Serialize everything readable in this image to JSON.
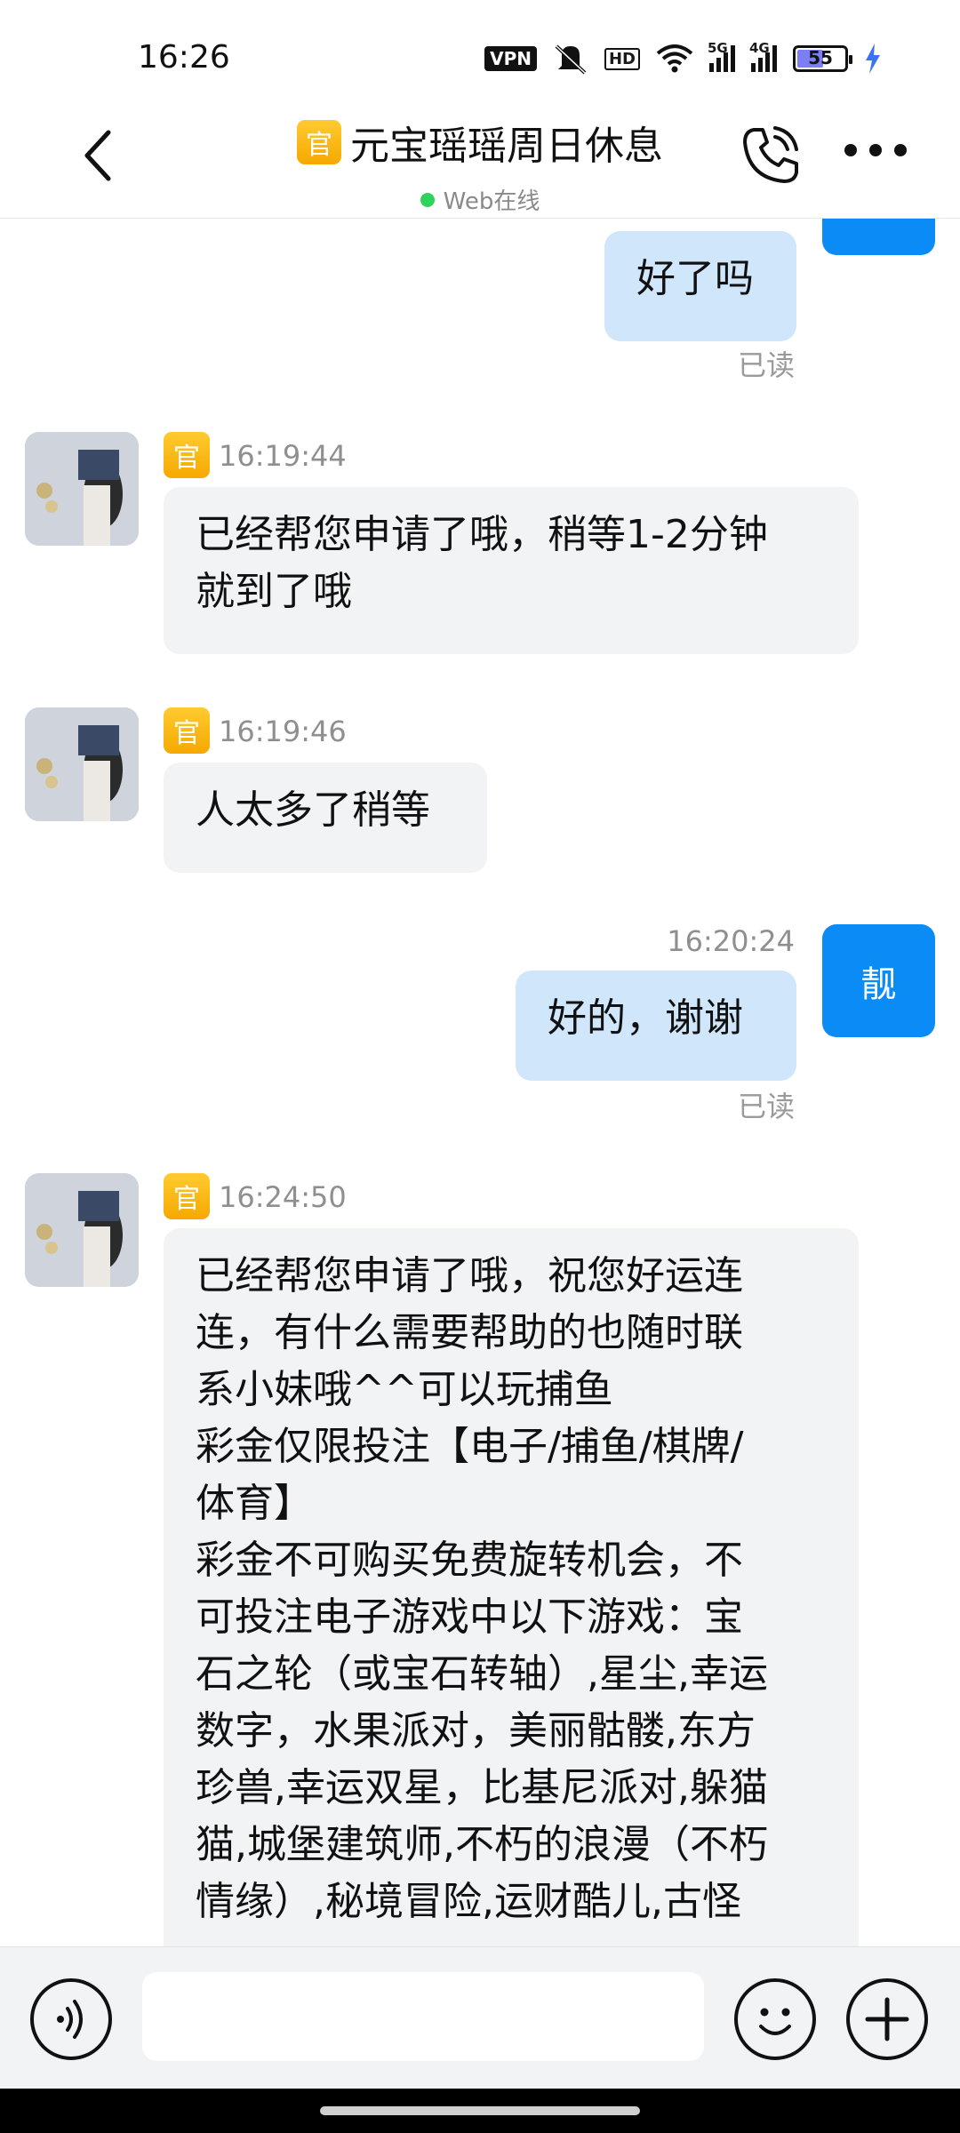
{
  "status_bar": {
    "time": "16:26",
    "vpn": "VPN",
    "hd": "HD",
    "net1": "5G",
    "net2": "4G",
    "battery": "55"
  },
  "header": {
    "badge": "官",
    "title": "元宝瑶瑶周日休息",
    "status": "Web在线"
  },
  "messages": [
    {
      "from": "me",
      "avatar": "靓",
      "text": "好了吗",
      "status": "已读"
    },
    {
      "from": "them",
      "badge": "官",
      "time": "16:19:44",
      "lines": [
        "已经帮您申请了哦，稍等1-2分钟",
        "就到了哦"
      ]
    },
    {
      "from": "them",
      "badge": "官",
      "time": "16:19:46",
      "text": "人太多了稍等"
    },
    {
      "from": "me",
      "avatar": "靓",
      "time": "16:20:24",
      "text": "好的，谢谢",
      "status": "已读"
    },
    {
      "from": "them",
      "badge": "官",
      "time": "16:24:50",
      "lines": [
        "已经帮您申请了哦，祝您好运连",
        "连，有什么需要帮助的也随时联",
        "系小妹哦^^可以玩捕鱼",
        "彩金仅限投注【电子/捕鱼/棋牌/",
        "体育】",
        "彩金不可购买免费旋转机会，不",
        "可投注电子游戏中以下游戏：宝",
        "石之轮（或宝石转轴）,星尘,幸运",
        "数字，水果派对，美丽骷髅,东方",
        "珍兽,幸运双星，比基尼派对,躲猫",
        "猫,城堡建筑师,不朽的浪漫（不朽",
        "情缘）,秘境冒险,运财酷儿,古怪"
      ]
    }
  ],
  "input": {
    "placeholder": ""
  }
}
